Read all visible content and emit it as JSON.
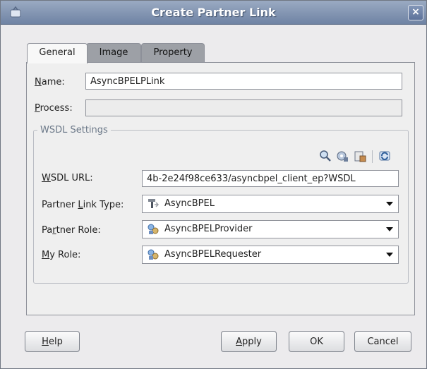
{
  "window": {
    "title": "Create Partner Link",
    "close_label": "×"
  },
  "tabs": [
    {
      "label": "General",
      "active": true
    },
    {
      "label": "Image",
      "active": false
    },
    {
      "label": "Property",
      "active": false
    }
  ],
  "form": {
    "name": {
      "label_accel": "N",
      "label_rest": "ame:",
      "value": "AsyncBPELPLink"
    },
    "process": {
      "label_accel": "P",
      "label_rest": "rocess:",
      "value": ""
    }
  },
  "wsdl": {
    "group_title": "WSDL Settings",
    "toolbar_icons": [
      "search-icon",
      "browse-services-icon",
      "service-explorer-icon",
      "refresh-icon"
    ],
    "url": {
      "label_accel": "W",
      "label_rest": "SDL URL:",
      "value": "4b-2e24f98ce633/asyncbpel_client_ep?WSDL"
    },
    "partner_link_type": {
      "label_pre": "Partner ",
      "label_accel": "L",
      "label_rest": "ink Type:",
      "value": "AsyncBPEL"
    },
    "partner_role": {
      "label_pre": "Pa",
      "label_accel": "r",
      "label_rest": "tner Role:",
      "value": "AsyncBPELProvider"
    },
    "my_role": {
      "label_accel": "M",
      "label_rest": "y Role:",
      "value": "AsyncBPELRequester"
    }
  },
  "buttons": {
    "help_accel": "H",
    "help_rest": "elp",
    "apply_accel": "A",
    "apply_rest": "pply",
    "ok": "OK",
    "cancel": "Cancel"
  },
  "colors": {
    "titlebar": "#7a8dab",
    "panel": "#efefef",
    "group_title": "#6b7888"
  }
}
